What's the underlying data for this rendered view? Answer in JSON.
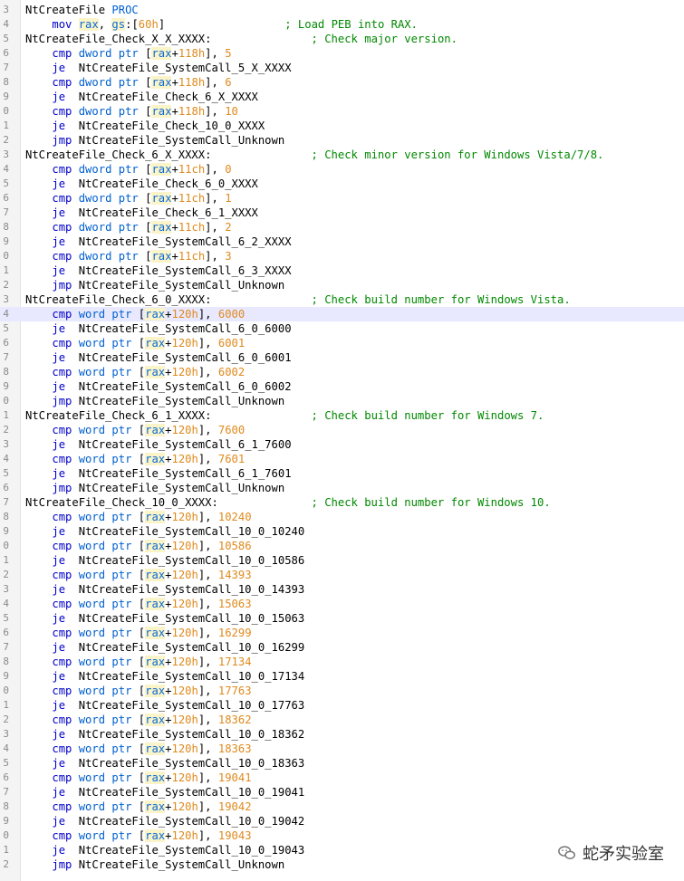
{
  "watermark": {
    "text": "蛇矛实验室"
  },
  "lines": [
    {
      "n": "3",
      "code": "NtCreateFile PROC"
    },
    {
      "n": "4",
      "code": "    mov rax, gs:[60h]                  ; Load PEB into RAX."
    },
    {
      "n": "5",
      "code": "NtCreateFile_Check_X_X_XXXX:               ; Check major version."
    },
    {
      "n": "6",
      "code": "    cmp dword ptr [rax+118h], 5"
    },
    {
      "n": "7",
      "code": "    je  NtCreateFile_SystemCall_5_X_XXXX"
    },
    {
      "n": "8",
      "code": "    cmp dword ptr [rax+118h], 6"
    },
    {
      "n": "9",
      "code": "    je  NtCreateFile_Check_6_X_XXXX"
    },
    {
      "n": "0",
      "code": "    cmp dword ptr [rax+118h], 10"
    },
    {
      "n": "1",
      "code": "    je  NtCreateFile_Check_10_0_XXXX"
    },
    {
      "n": "2",
      "code": "    jmp NtCreateFile_SystemCall_Unknown"
    },
    {
      "n": "3",
      "code": "NtCreateFile_Check_6_X_XXXX:               ; Check minor version for Windows Vista/7/8."
    },
    {
      "n": "4",
      "code": "    cmp dword ptr [rax+11ch], 0"
    },
    {
      "n": "5",
      "code": "    je  NtCreateFile_Check_6_0_XXXX"
    },
    {
      "n": "6",
      "code": "    cmp dword ptr [rax+11ch], 1"
    },
    {
      "n": "7",
      "code": "    je  NtCreateFile_Check_6_1_XXXX"
    },
    {
      "n": "8",
      "code": "    cmp dword ptr [rax+11ch], 2"
    },
    {
      "n": "9",
      "code": "    je  NtCreateFile_SystemCall_6_2_XXXX"
    },
    {
      "n": "0",
      "code": "    cmp dword ptr [rax+11ch], 3"
    },
    {
      "n": "1",
      "code": "    je  NtCreateFile_SystemCall_6_3_XXXX"
    },
    {
      "n": "2",
      "code": "    jmp NtCreateFile_SystemCall_Unknown"
    },
    {
      "n": "3",
      "code": "NtCreateFile_Check_6_0_XXXX:               ; Check build number for Windows Vista."
    },
    {
      "n": "4",
      "code": "    cmp word ptr [rax+120h], 6000",
      "current": true
    },
    {
      "n": "5",
      "code": "    je  NtCreateFile_SystemCall_6_0_6000"
    },
    {
      "n": "6",
      "code": "    cmp word ptr [rax+120h], 6001"
    },
    {
      "n": "7",
      "code": "    je  NtCreateFile_SystemCall_6_0_6001"
    },
    {
      "n": "8",
      "code": "    cmp word ptr [rax+120h], 6002"
    },
    {
      "n": "9",
      "code": "    je  NtCreateFile_SystemCall_6_0_6002"
    },
    {
      "n": "0",
      "code": "    jmp NtCreateFile_SystemCall_Unknown"
    },
    {
      "n": "1",
      "code": "NtCreateFile_Check_6_1_XXXX:               ; Check build number for Windows 7."
    },
    {
      "n": "2",
      "code": "    cmp word ptr [rax+120h], 7600"
    },
    {
      "n": "3",
      "code": "    je  NtCreateFile_SystemCall_6_1_7600"
    },
    {
      "n": "4",
      "code": "    cmp word ptr [rax+120h], 7601"
    },
    {
      "n": "5",
      "code": "    je  NtCreateFile_SystemCall_6_1_7601"
    },
    {
      "n": "6",
      "code": "    jmp NtCreateFile_SystemCall_Unknown"
    },
    {
      "n": "7",
      "code": "NtCreateFile_Check_10_0_XXXX:              ; Check build number for Windows 10."
    },
    {
      "n": "8",
      "code": "    cmp word ptr [rax+120h], 10240"
    },
    {
      "n": "9",
      "code": "    je  NtCreateFile_SystemCall_10_0_10240"
    },
    {
      "n": "0",
      "code": "    cmp word ptr [rax+120h], 10586"
    },
    {
      "n": "1",
      "code": "    je  NtCreateFile_SystemCall_10_0_10586"
    },
    {
      "n": "2",
      "code": "    cmp word ptr [rax+120h], 14393"
    },
    {
      "n": "3",
      "code": "    je  NtCreateFile_SystemCall_10_0_14393"
    },
    {
      "n": "4",
      "code": "    cmp word ptr [rax+120h], 15063"
    },
    {
      "n": "5",
      "code": "    je  NtCreateFile_SystemCall_10_0_15063"
    },
    {
      "n": "6",
      "code": "    cmp word ptr [rax+120h], 16299"
    },
    {
      "n": "7",
      "code": "    je  NtCreateFile_SystemCall_10_0_16299"
    },
    {
      "n": "8",
      "code": "    cmp word ptr [rax+120h], 17134"
    },
    {
      "n": "9",
      "code": "    je  NtCreateFile_SystemCall_10_0_17134"
    },
    {
      "n": "0",
      "code": "    cmp word ptr [rax+120h], 17763"
    },
    {
      "n": "1",
      "code": "    je  NtCreateFile_SystemCall_10_0_17763"
    },
    {
      "n": "2",
      "code": "    cmp word ptr [rax+120h], 18362"
    },
    {
      "n": "3",
      "code": "    je  NtCreateFile_SystemCall_10_0_18362"
    },
    {
      "n": "4",
      "code": "    cmp word ptr [rax+120h], 18363"
    },
    {
      "n": "5",
      "code": "    je  NtCreateFile_SystemCall_10_0_18363"
    },
    {
      "n": "6",
      "code": "    cmp word ptr [rax+120h], 19041"
    },
    {
      "n": "7",
      "code": "    je  NtCreateFile_SystemCall_10_0_19041"
    },
    {
      "n": "8",
      "code": "    cmp word ptr [rax+120h], 19042"
    },
    {
      "n": "9",
      "code": "    je  NtCreateFile_SystemCall_10_0_19042"
    },
    {
      "n": "0",
      "code": "    cmp word ptr [rax+120h], 19043"
    },
    {
      "n": "1",
      "code": "    je  NtCreateFile_SystemCall_10_0_19043"
    },
    {
      "n": "2",
      "code": "    jmp NtCreateFile_SystemCall_Unknown"
    }
  ]
}
